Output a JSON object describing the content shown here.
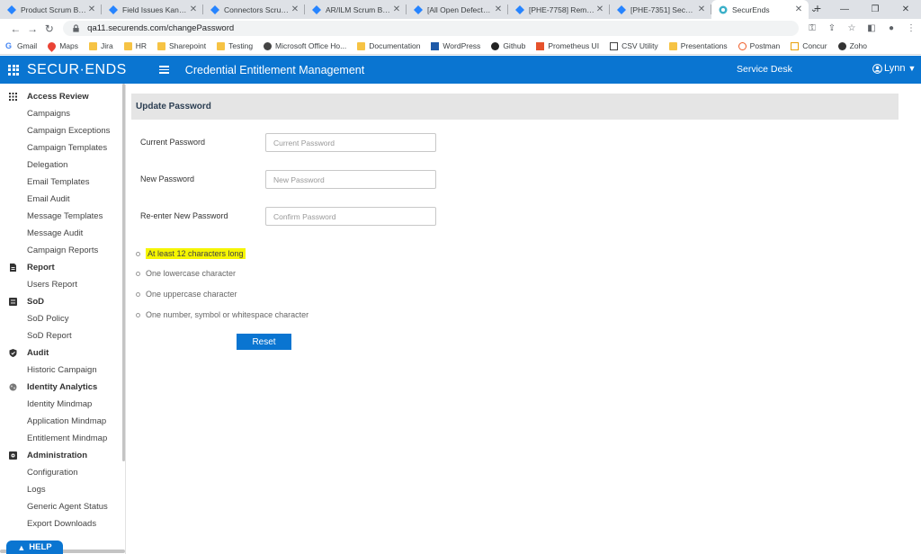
{
  "browser": {
    "tabs": [
      {
        "label": "Product Scrum Board"
      },
      {
        "label": "Field Issues Kanban B"
      },
      {
        "label": "Connectors Scrum Bo"
      },
      {
        "label": "AR/ILM Scrum Board"
      },
      {
        "label": "[All Open Defects] Iss"
      },
      {
        "label": "[PHE-7758] Remove"
      },
      {
        "label": "[PHE-7351] SecurEnd"
      },
      {
        "label": "SecurEnds"
      }
    ],
    "url": "qa11.securends.com/changePassword",
    "bookmarks": [
      {
        "label": "Gmail"
      },
      {
        "label": "Maps"
      },
      {
        "label": "Jira"
      },
      {
        "label": "HR"
      },
      {
        "label": "Sharepoint"
      },
      {
        "label": "Testing"
      },
      {
        "label": "Microsoft Office Ho..."
      },
      {
        "label": "Documentation"
      },
      {
        "label": "WordPress"
      },
      {
        "label": "Github"
      },
      {
        "label": "Prometheus UI"
      },
      {
        "label": "CSV Utility"
      },
      {
        "label": "Presentations"
      },
      {
        "label": "Postman"
      },
      {
        "label": "Concur"
      },
      {
        "label": "Zoho"
      }
    ]
  },
  "header": {
    "logo": "SECUR·ENDS",
    "title": "Credential Entitlement Management",
    "service_desk": "Service Desk",
    "user": "Lynn"
  },
  "sidebar": {
    "access_review": {
      "label": "Access Review",
      "items": [
        "Campaigns",
        "Campaign Exceptions",
        "Campaign Templates",
        "Delegation",
        "Email Templates",
        "Email Audit",
        "Message Templates",
        "Message Audit",
        "Campaign Reports"
      ]
    },
    "report": {
      "label": "Report",
      "items": [
        "Users Report"
      ]
    },
    "sod": {
      "label": "SoD",
      "items": [
        "SoD Policy",
        "SoD Report"
      ]
    },
    "audit": {
      "label": "Audit",
      "items": [
        "Historic Campaign"
      ]
    },
    "identity_analytics": {
      "label": "Identity Analytics",
      "items": [
        "Identity Mindmap",
        "Application Mindmap",
        "Entitlement Mindmap"
      ]
    },
    "administration": {
      "label": "Administration",
      "items": [
        "Configuration",
        "Logs",
        "Generic Agent Status",
        "Export Downloads"
      ]
    },
    "help": "HELP"
  },
  "form": {
    "heading": "Update Password",
    "current": {
      "label": "Current Password",
      "placeholder": "Current Password",
      "value": ""
    },
    "new": {
      "label": "New Password",
      "placeholder": "New Password",
      "value": ""
    },
    "confirm": {
      "label": "Re-enter New Password",
      "placeholder": "Confirm Password",
      "value": ""
    },
    "rules": [
      {
        "text": "At least 12 characters long",
        "highlighted": true
      },
      {
        "text": "One lowercase character",
        "highlighted": false
      },
      {
        "text": "One uppercase character",
        "highlighted": false
      },
      {
        "text": "One number, symbol or whitespace character",
        "highlighted": false
      }
    ],
    "reset_label": "Reset"
  },
  "colors": {
    "brand": "#0a75d1",
    "highlight": "#f5f500",
    "panel": "#e5e5e5"
  }
}
